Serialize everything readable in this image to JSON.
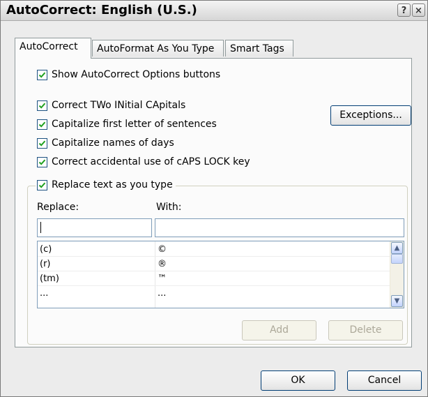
{
  "window": {
    "title": "AutoCorrect: English (U.S.)",
    "help_glyph": "?",
    "close_glyph": "×"
  },
  "tabs": [
    {
      "label": "AutoCorrect",
      "active": true
    },
    {
      "label": "AutoFormat As You Type",
      "active": false
    },
    {
      "label": "Smart Tags",
      "active": false
    }
  ],
  "options": {
    "show_buttons": {
      "label": "Show AutoCorrect Options buttons",
      "checked": true
    },
    "two_initial_caps": {
      "label": "Correct TWo INitial CApitals",
      "checked": true
    },
    "capitalize_sentences": {
      "label": "Capitalize first letter of sentences",
      "checked": true
    },
    "capitalize_days": {
      "label": "Capitalize names of days",
      "checked": true
    },
    "caps_lock": {
      "label": "Correct accidental use of cAPS LOCK key",
      "checked": true
    },
    "replace_text": {
      "label": "Replace text as you type",
      "checked": true
    }
  },
  "exceptions_button": "Exceptions...",
  "replace": {
    "replace_label": "Replace:",
    "with_label": "With:",
    "replace_value": "",
    "with_value": "",
    "rows": [
      {
        "replace": "(c)",
        "with": "©"
      },
      {
        "replace": "(r)",
        "with": "®"
      },
      {
        "replace": "(tm)",
        "with": "™"
      },
      {
        "replace": "...",
        "with": "..."
      }
    ],
    "add_button": "Add",
    "delete_button": "Delete"
  },
  "footer": {
    "ok_button": "OK",
    "cancel_button": "Cancel"
  },
  "colors": {
    "accent_border": "#003c74",
    "checkmark": "#21a121"
  }
}
